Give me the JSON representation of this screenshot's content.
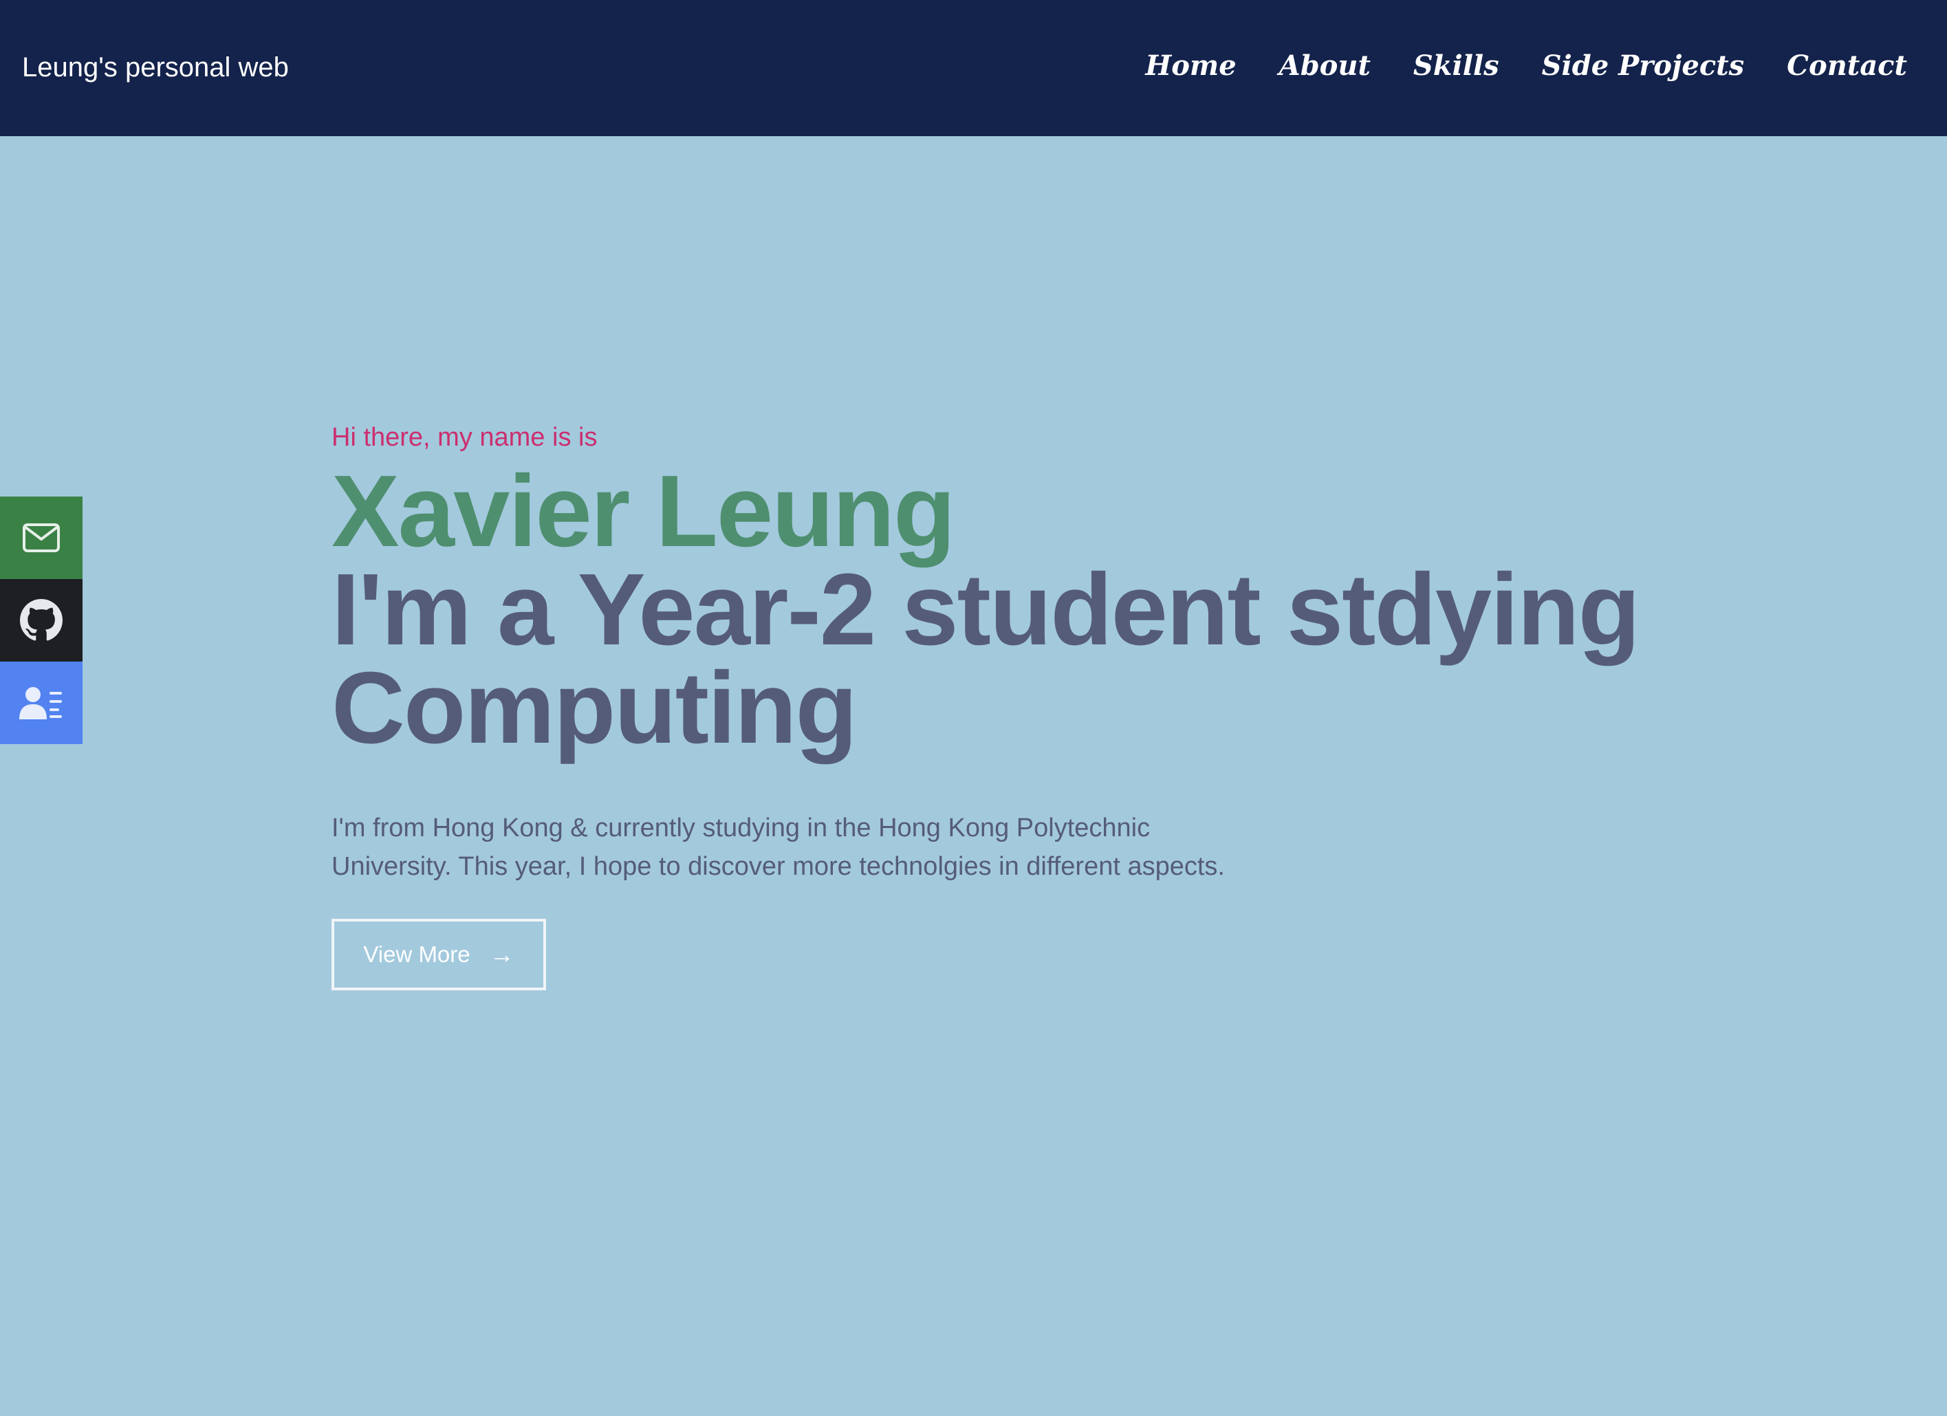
{
  "navbar": {
    "brand": "Leung's personal web",
    "links": [
      "Home",
      "About",
      "Skills",
      "Side Projects",
      "Contact"
    ]
  },
  "social": {
    "items": [
      {
        "icon": "mail-icon",
        "color": "#3a8145"
      },
      {
        "icon": "github-icon",
        "color": "#1d1f23"
      },
      {
        "icon": "resume-icon",
        "color": "#5283f0"
      }
    ]
  },
  "hero": {
    "greeting": "Hi there, my name is is",
    "name": "Xavier Leung",
    "tagline_line1": "I'm a Year-2 student stdying",
    "tagline_line2": "Computing",
    "description_line1": "I'm from Hong Kong & currently studying in the Hong Kong Polytechnic",
    "description_line2": "University. This year, I hope to discover more technolgies in different aspects.",
    "button_label": "View More",
    "button_arrow": "→"
  },
  "colors": {
    "background": "#a3c9dd",
    "navbar": "#14234b",
    "greeting": "#cb2f6f",
    "name": "#4e8f6f",
    "tagline": "#555c7a"
  }
}
